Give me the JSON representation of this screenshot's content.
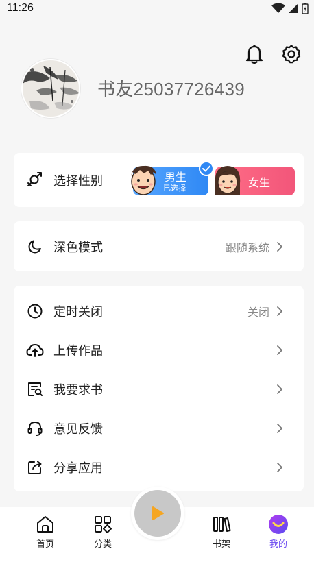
{
  "status_bar": {
    "time": "11:26"
  },
  "profile": {
    "username": "书友25037726439"
  },
  "gender": {
    "label": "选择性别",
    "male": {
      "label": "男生",
      "sub": "已选择"
    },
    "female": {
      "label": "女生"
    }
  },
  "dark_mode": {
    "label": "深色模式",
    "value": "跟随系统"
  },
  "menu": {
    "timer": {
      "label": "定时关闭",
      "value": "关闭"
    },
    "upload": {
      "label": "上传作品"
    },
    "request": {
      "label": "我要求书"
    },
    "feedback": {
      "label": "意见反馈"
    },
    "share": {
      "label": "分享应用"
    }
  },
  "tabbar": {
    "home": "首页",
    "category": "分类",
    "bookshelf": "书架",
    "mine": "我的"
  },
  "colors": {
    "accent": "#6d4cf0",
    "male": "#2f88f4",
    "female": "#f2567a"
  },
  "icons": {
    "header": [
      "bell-icon",
      "settings-gear-icon"
    ],
    "menu": [
      "clock-icon",
      "cloud-upload-icon",
      "book-search-icon",
      "headset-icon",
      "share-icon"
    ]
  }
}
